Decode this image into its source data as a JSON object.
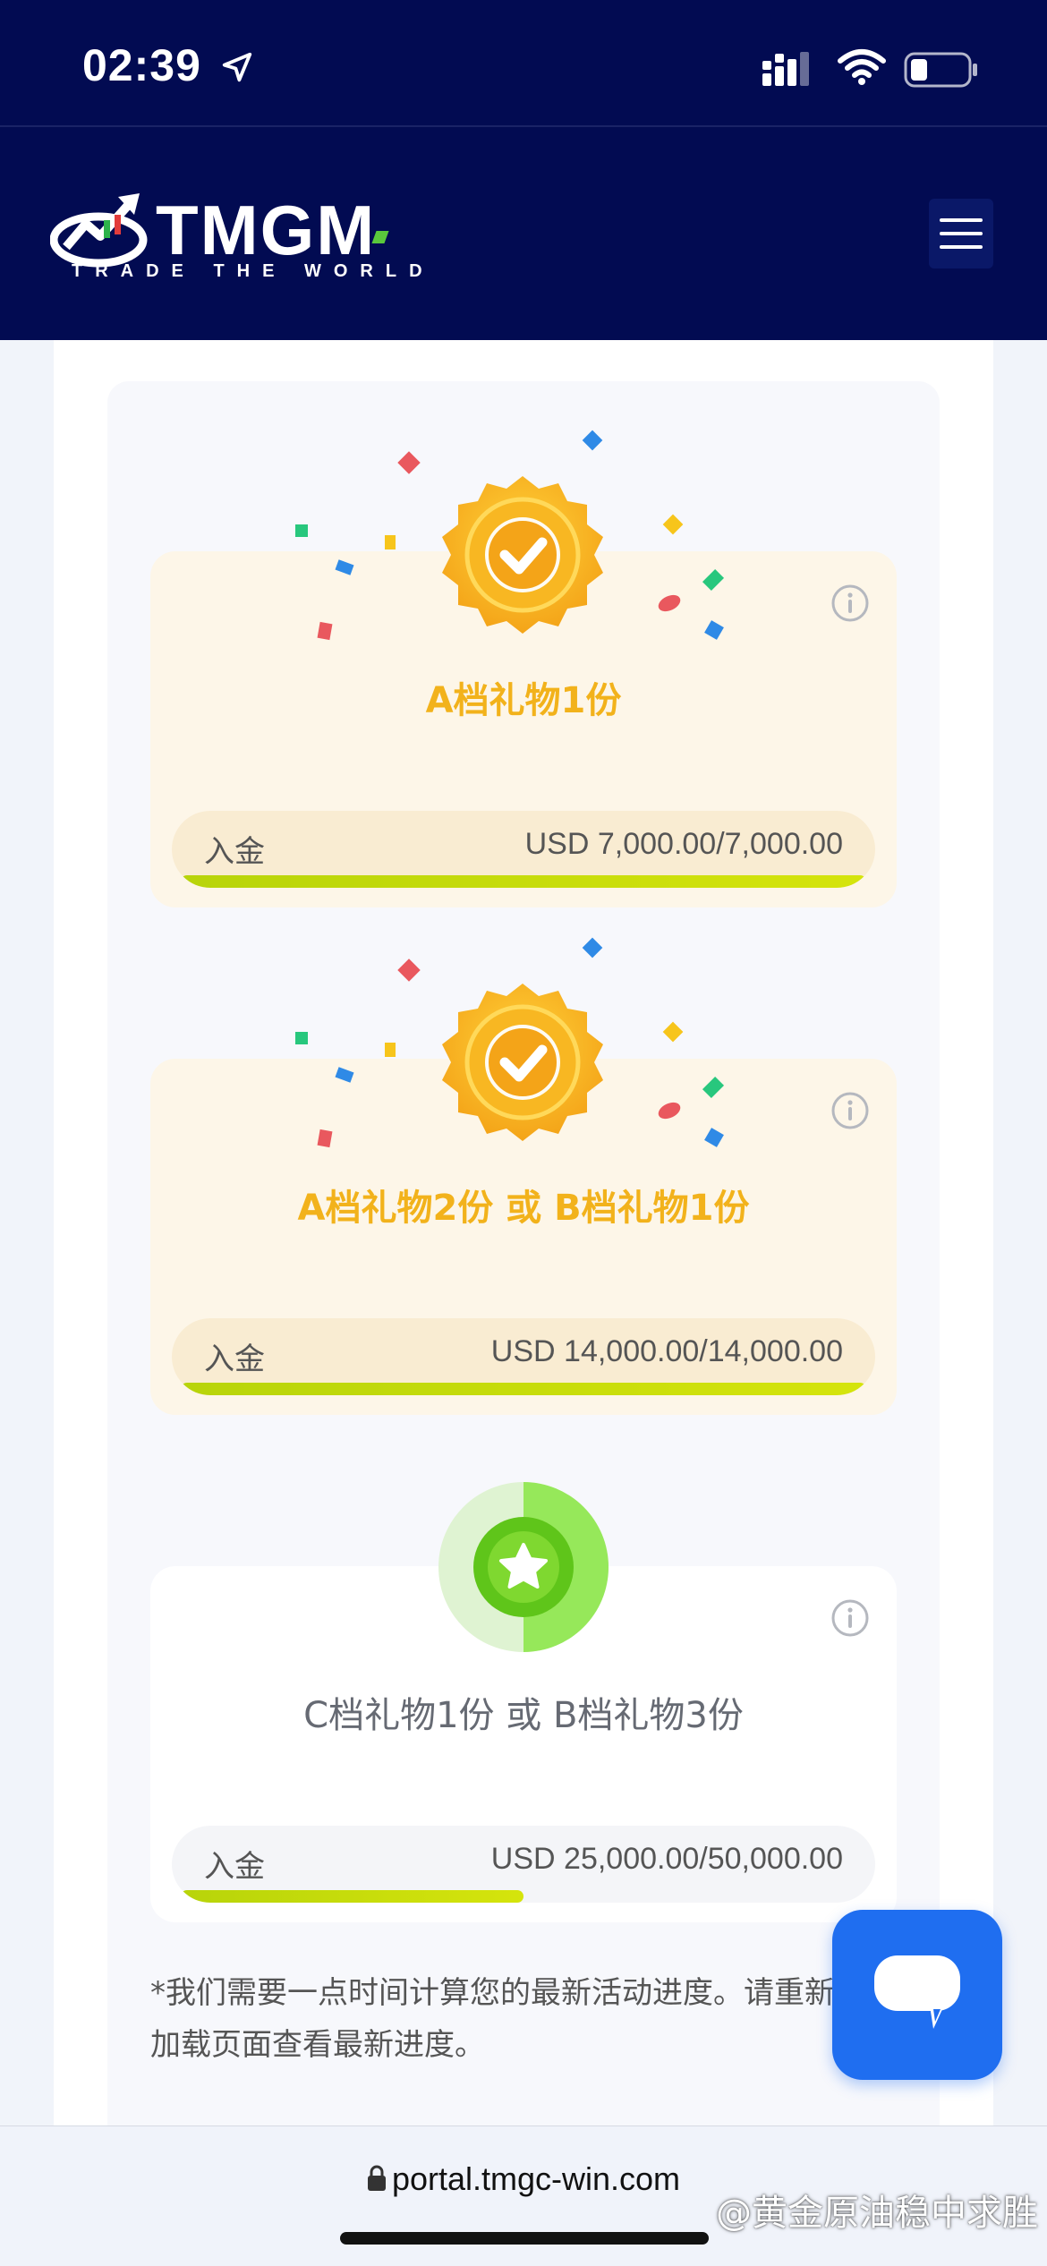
{
  "status_bar": {
    "time": "02:39"
  },
  "header": {
    "logo_text": "TMGM",
    "logo_tagline": "TRADE THE WORLD"
  },
  "tiers": [
    {
      "title": "A档礼物1份",
      "status": "completed",
      "label": "入金",
      "progress_text": "USD 7,000.00/7,000.00",
      "progress_fraction": 1.0
    },
    {
      "title": "A档礼物2份 或 B档礼物1份",
      "status": "completed",
      "label": "入金",
      "progress_text": "USD 14,000.00/14,000.00",
      "progress_fraction": 1.0
    },
    {
      "title": "C档礼物1份 或 B档礼物3份",
      "status": "in-progress",
      "label": "入金",
      "progress_text": "USD 25,000.00/50,000.00",
      "progress_fraction": 0.5
    }
  ],
  "note": "*我们需要一点时间计算您的最新活动进度。请重新加载页面查看最新进度。",
  "browser": {
    "url": "portal.tmgc-win.com"
  },
  "watermark": "@黄金原油稳中求胜",
  "colors": {
    "header_bg": "#020b52",
    "gold": "#f2b21b",
    "progress": "#c4dc0c",
    "chat_button": "#1f6ef0",
    "badge_green": "#6fcf1f"
  },
  "icons": [
    "location-arrow-icon",
    "signal-icon",
    "wifi-icon",
    "battery-icon",
    "tmgm-logo-icon",
    "hamburger-menu-icon",
    "check-badge-icon",
    "info-icon",
    "star-badge-icon",
    "chat-icon",
    "lock-icon"
  ]
}
